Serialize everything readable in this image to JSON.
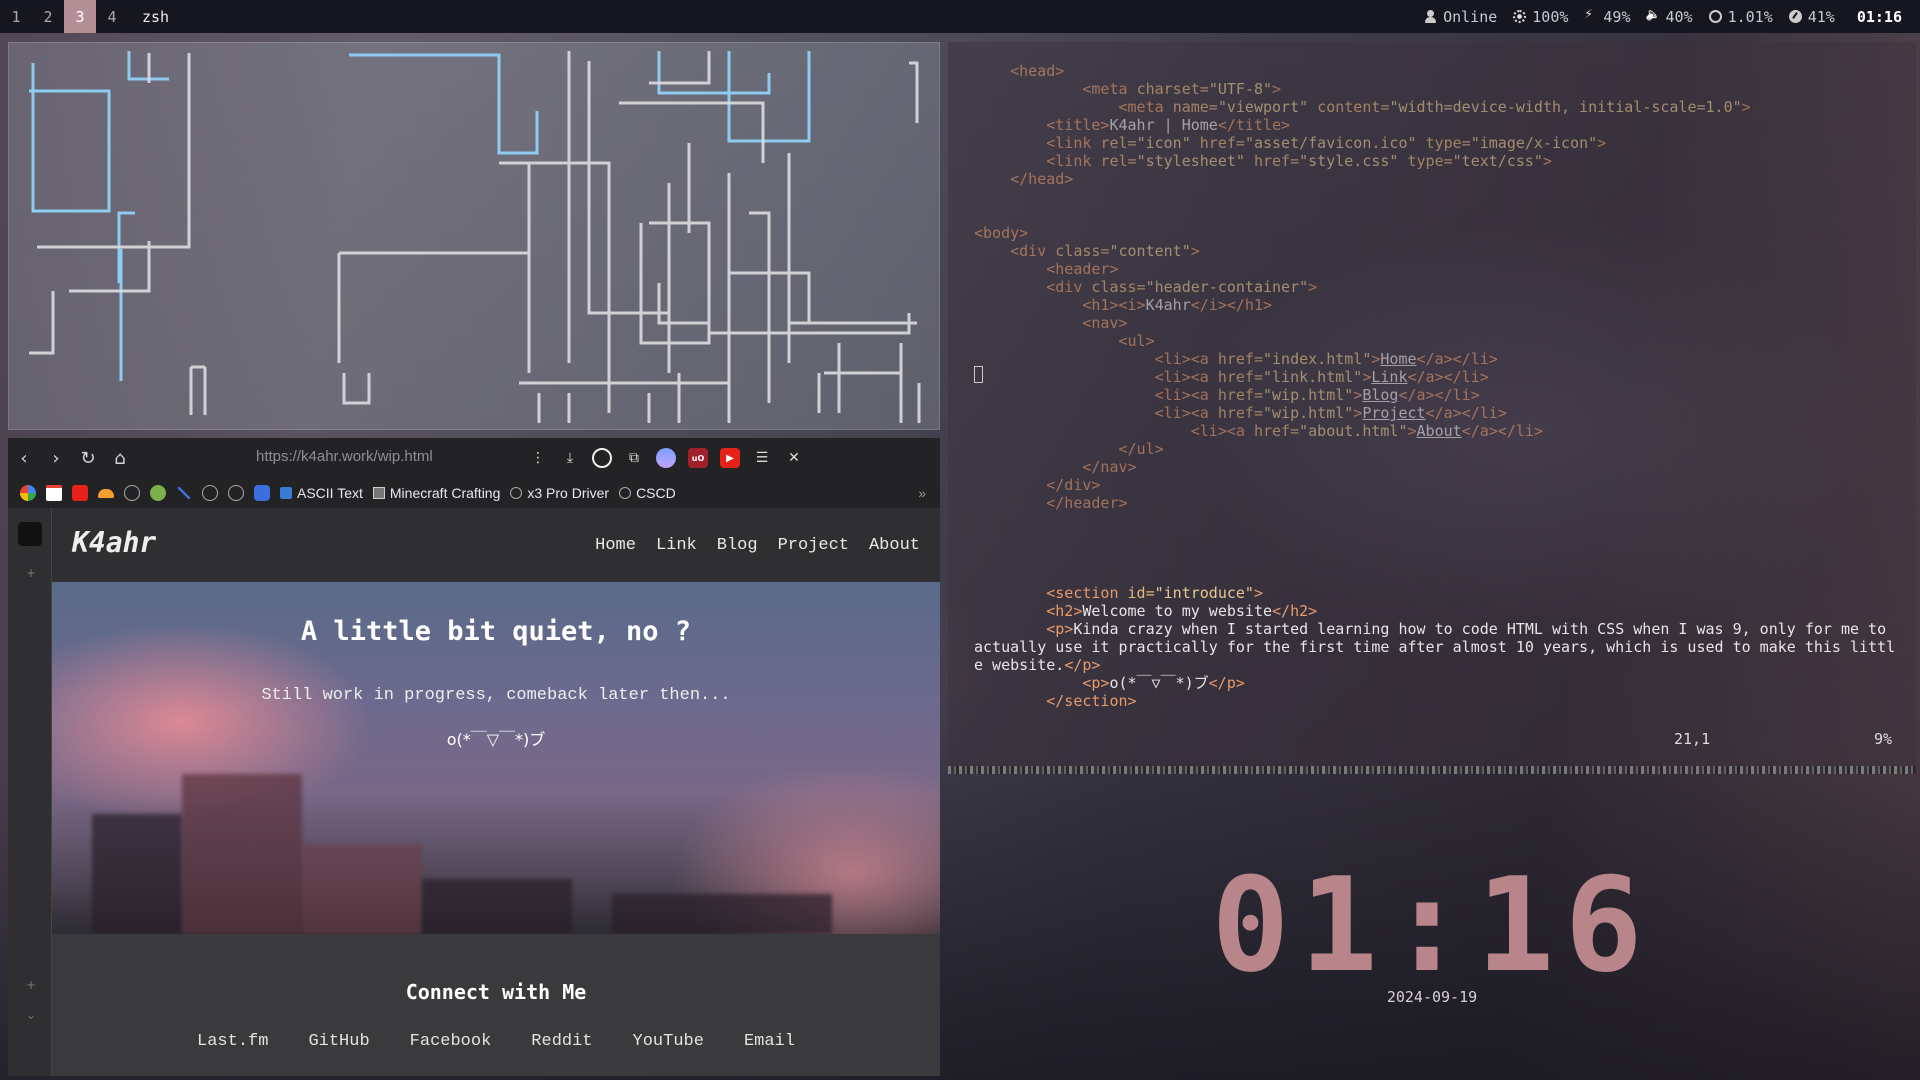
{
  "topbar": {
    "workspaces": [
      "1",
      "2",
      "3",
      "4"
    ],
    "active_workspace": "3",
    "window_title": "zsh",
    "status": {
      "network": "Online",
      "brightness": "100%",
      "battery": "49%",
      "volume": "40%",
      "cpu": "1.01%",
      "disk": "41%",
      "clock": "01:16"
    }
  },
  "browser": {
    "url": "https://k4ahr.work/wip.html",
    "bookmarks": [
      "ASCII Text",
      "Minecraft Crafting",
      "x3 Pro Driver",
      "CSCD"
    ],
    "site": {
      "logo": "K4ahr",
      "menu": [
        "Home",
        "Link",
        "Blog",
        "Project",
        "About"
      ],
      "hero_title": "A little bit quiet, no ?",
      "hero_sub": "Still work in progress, comeback later then...",
      "hero_kaomoji": "o(*￣▽￣*)ブ",
      "connect_title": "Connect with Me",
      "connect_links": [
        "Last.fm",
        "GitHub",
        "Facebook",
        "Reddit",
        "YouTube",
        "Email"
      ]
    }
  },
  "editor": {
    "cursor_position": "21,1",
    "scroll_percent": "9%"
  },
  "clock": {
    "time": "01:16",
    "date": "2024-09-19"
  },
  "colors": {
    "accent": "#b58f96",
    "clock": "#b8868a",
    "pipe_blue": "#8ecbf0",
    "pipe_white": "#dcdce0"
  }
}
